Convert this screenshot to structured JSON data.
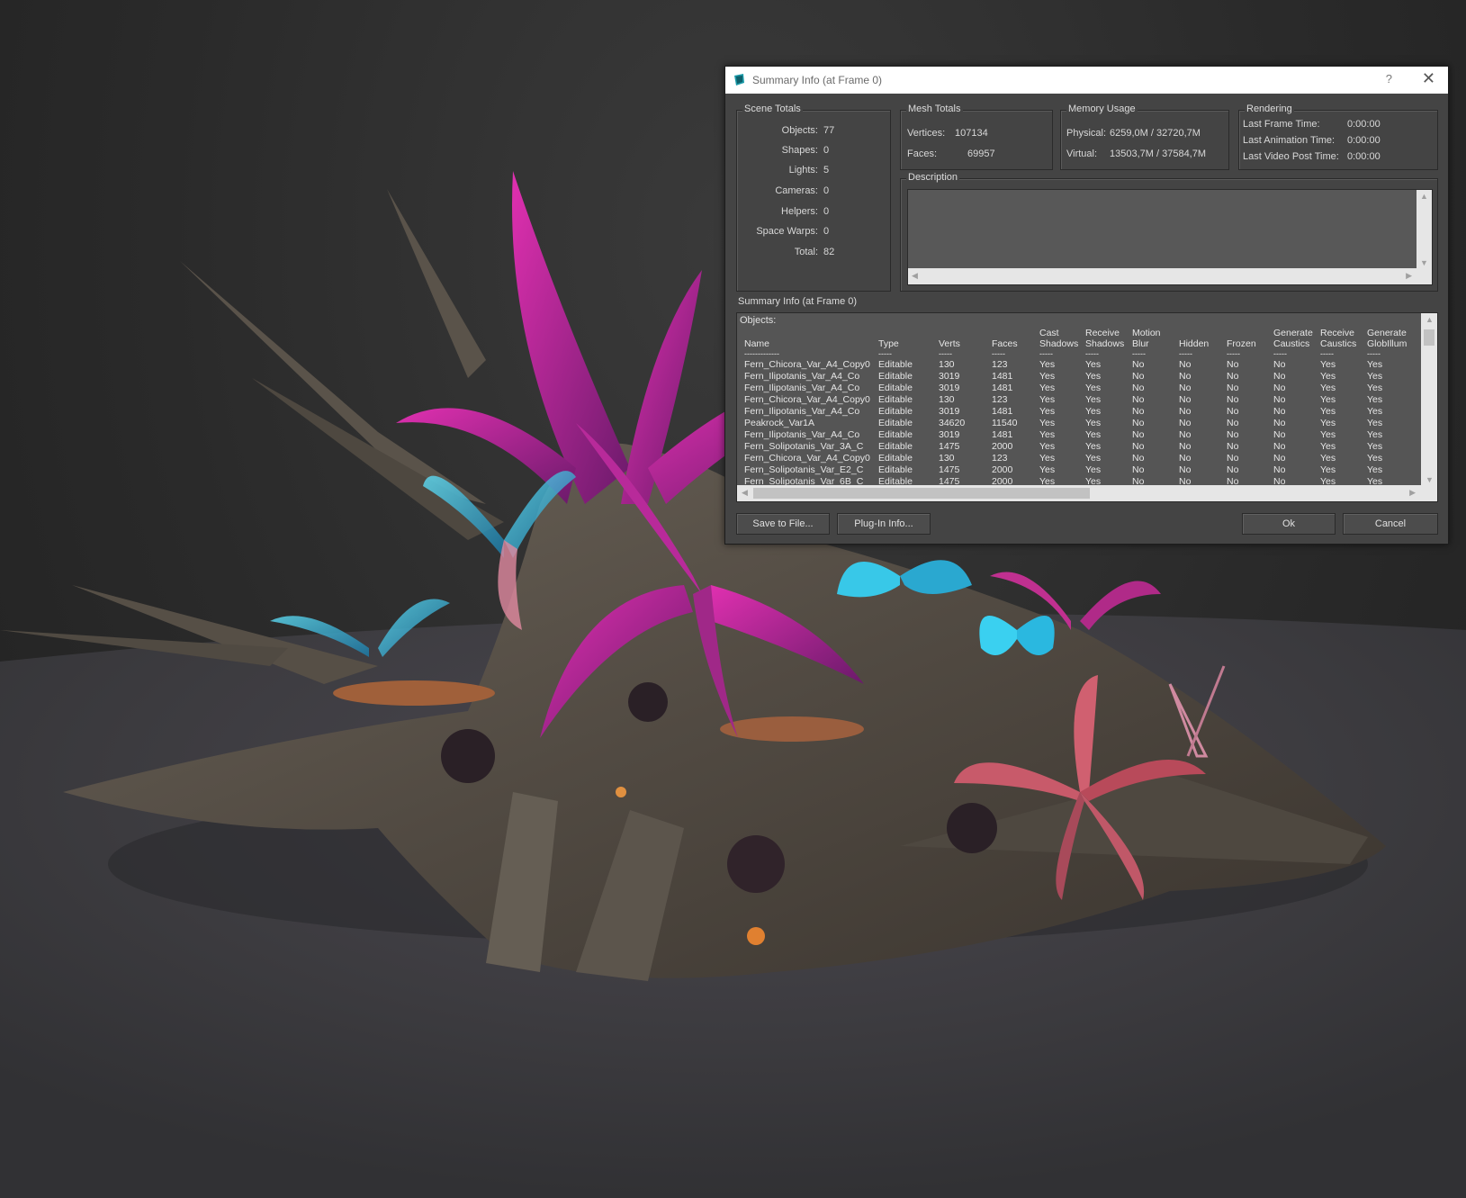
{
  "dialog": {
    "title": "Summary Info (at Frame 0)",
    "help": "?",
    "close": "✕"
  },
  "scene_totals": {
    "legend": "Scene Totals",
    "rows": [
      {
        "label": "Objects:",
        "value": "77"
      },
      {
        "label": "Shapes:",
        "value": "0"
      },
      {
        "label": "Lights:",
        "value": "5"
      },
      {
        "label": "Cameras:",
        "value": "0"
      },
      {
        "label": "Helpers:",
        "value": "0"
      },
      {
        "label": "Space Warps:",
        "value": "0"
      },
      {
        "label": "Total:",
        "value": "82"
      }
    ]
  },
  "mesh_totals": {
    "legend": "Mesh Totals",
    "vertices_label": "Vertices:",
    "vertices": "107134",
    "faces_label": "Faces:",
    "faces": "69957"
  },
  "memory_usage": {
    "legend": "Memory Usage",
    "physical_label": "Physical:",
    "physical": "6259,0M / 32720,7M",
    "virtual_label": "Virtual:",
    "virtual": "13503,7M / 37584,7M"
  },
  "rendering": {
    "legend": "Rendering",
    "last_frame_label": "Last Frame Time:",
    "last_frame": "0:00:00",
    "last_anim_label": "Last Animation Time:",
    "last_anim": "0:00:00",
    "last_video_label": "Last Video Post Time:",
    "last_video": "0:00:00"
  },
  "description": {
    "legend": "Description"
  },
  "summary": {
    "label": "Summary Info (at Frame 0)",
    "objects_label": "Objects:",
    "headers": [
      "Name",
      "Type",
      "Verts",
      "Faces",
      "Cast Shadows",
      "Receive Shadows",
      "Motion Blur",
      "Hidden",
      "Frozen",
      "Generate Caustics",
      "Receive Caustics",
      "Generate GlobIllum"
    ],
    "dashes": [
      "-------------",
      "-----",
      "-----",
      "-----",
      "-----",
      "-----",
      "-----",
      "-----",
      "-----",
      "-----",
      "-----",
      "-----"
    ],
    "rows": [
      [
        "Fern_Chicora_Var_A4_Copy0",
        "Editable",
        "130",
        "123",
        "Yes",
        "Yes",
        "No",
        "No",
        "No",
        "No",
        "Yes",
        "Yes"
      ],
      [
        "Fern_Ilipotanis_Var_A4_Co",
        "Editable",
        "3019",
        "1481",
        "Yes",
        "Yes",
        "No",
        "No",
        "No",
        "No",
        "Yes",
        "Yes"
      ],
      [
        "Fern_Ilipotanis_Var_A4_Co",
        "Editable",
        "3019",
        "1481",
        "Yes",
        "Yes",
        "No",
        "No",
        "No",
        "No",
        "Yes",
        "Yes"
      ],
      [
        "Fern_Chicora_Var_A4_Copy0",
        "Editable",
        "130",
        "123",
        "Yes",
        "Yes",
        "No",
        "No",
        "No",
        "No",
        "Yes",
        "Yes"
      ],
      [
        "Fern_Ilipotanis_Var_A4_Co",
        "Editable",
        "3019",
        "1481",
        "Yes",
        "Yes",
        "No",
        "No",
        "No",
        "No",
        "Yes",
        "Yes"
      ],
      [
        "Peakrock_Var1A",
        "Editable",
        "34620",
        "11540",
        "Yes",
        "Yes",
        "No",
        "No",
        "No",
        "No",
        "Yes",
        "Yes"
      ],
      [
        "Fern_Ilipotanis_Var_A4_Co",
        "Editable",
        "3019",
        "1481",
        "Yes",
        "Yes",
        "No",
        "No",
        "No",
        "No",
        "Yes",
        "Yes"
      ],
      [
        "Fern_Solipotanis_Var_3A_C",
        "Editable",
        "1475",
        "2000",
        "Yes",
        "Yes",
        "No",
        "No",
        "No",
        "No",
        "Yes",
        "Yes"
      ],
      [
        "Fern_Chicora_Var_A4_Copy0",
        "Editable",
        "130",
        "123",
        "Yes",
        "Yes",
        "No",
        "No",
        "No",
        "No",
        "Yes",
        "Yes"
      ],
      [
        "Fern_Solipotanis_Var_E2_C",
        "Editable",
        "1475",
        "2000",
        "Yes",
        "Yes",
        "No",
        "No",
        "No",
        "No",
        "Yes",
        "Yes"
      ],
      [
        "Fern_Solipotanis_Var_6B_C",
        "Editable",
        "1475",
        "2000",
        "Yes",
        "Yes",
        "No",
        "No",
        "No",
        "No",
        "Yes",
        "Yes"
      ]
    ]
  },
  "buttons": {
    "save": "Save to File...",
    "plugin": "Plug-In Info...",
    "ok": "Ok",
    "cancel": "Cancel"
  },
  "colors": {
    "dialog_bg": "#444444",
    "fern_magenta": "#c0208f",
    "fern_cyan": "#38c8e8",
    "coral_red": "#c85a6a"
  },
  "icons": {
    "app": "3ds-max-app-icon",
    "help": "help-icon",
    "close": "close-icon"
  }
}
